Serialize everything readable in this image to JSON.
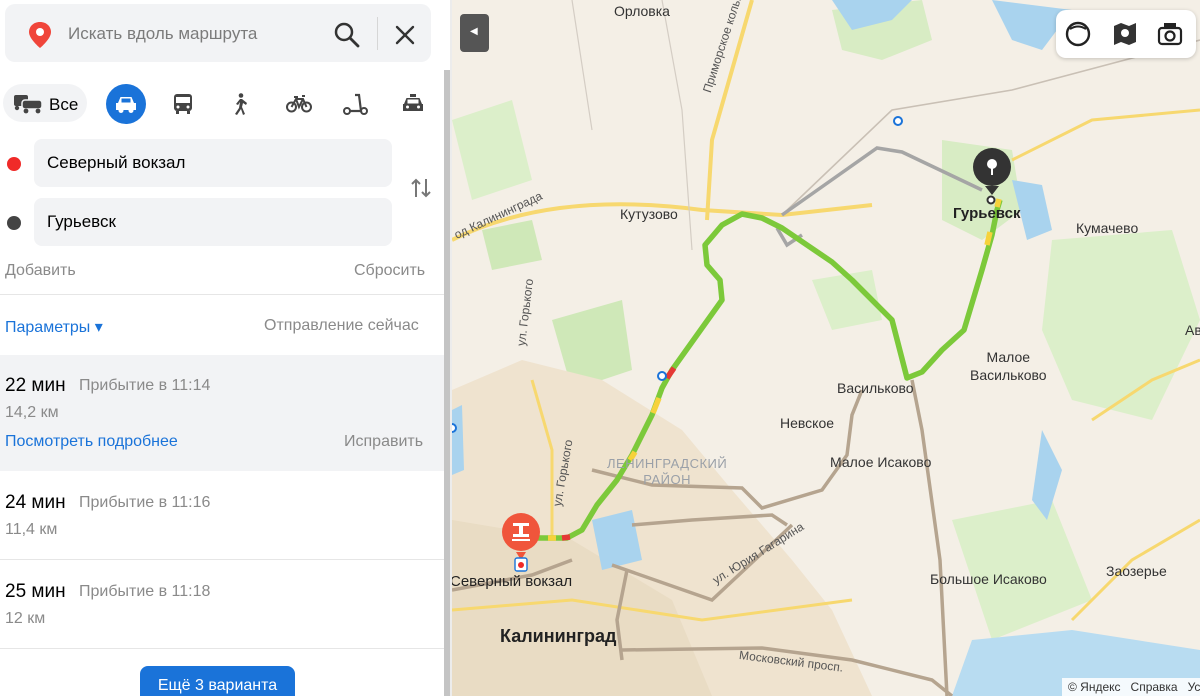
{
  "search": {
    "placeholder": "Искать вдоль маршрута"
  },
  "modes": {
    "all_label": "Все"
  },
  "route": {
    "from": "Северный вокзал",
    "to": "Гурьевск"
  },
  "actions": {
    "add": "Добавить",
    "reset": "Сбросить",
    "params": "Параметры ▾",
    "depart": "Отправление сейчас"
  },
  "options": [
    {
      "time": "22 мин",
      "arrival": "Прибытие в 11:14",
      "distance": "14,2 км",
      "details": "Посмотреть подробнее",
      "fix": "Исправить"
    },
    {
      "time": "24 мин",
      "arrival": "Прибытие в 11:16",
      "distance": "11,4 км"
    },
    {
      "time": "25 мин",
      "arrival": "Прибытие в 11:18",
      "distance": "12 км"
    }
  ],
  "more_button": "Ещё 3 варианта",
  "map": {
    "labels": {
      "orlovka": "Орловка",
      "primorskoe": "Приморское кольцо",
      "kutuzovo": "Кутузово",
      "kaliningrad_road": "од Калининграда",
      "gorkogo1": "ул. Горького",
      "gorkogo2": "ул. Горького",
      "guryevsk": "Гурьевск",
      "kumachevo": "Кумачево",
      "av": "Ав",
      "maloe_vasilkovo": "Малое\nВасильково",
      "vasilkovo": "Васильково",
      "nevskoe": "Невское",
      "district": "ЛЕНИНГРАДСКИЙ\nРАЙОН",
      "maloe_isakovo": "Малое Исаково",
      "gagarina": "ул. Юрия Гагарина",
      "bolshoe_isakovo": "Большое Исаково",
      "zaozerye": "Заозерье",
      "severny": "Северный вокзал",
      "kaliningrad": "Калининград",
      "moskovsky": "Московский просп."
    },
    "copyright": "© Яндекс",
    "help": "Справка",
    "cut": "Ус"
  },
  "colors": {
    "accent": "#1a73d9",
    "route_green": "#7cc93a",
    "route_gray": "#9e9e9e",
    "start_marker": "#f0553b"
  }
}
